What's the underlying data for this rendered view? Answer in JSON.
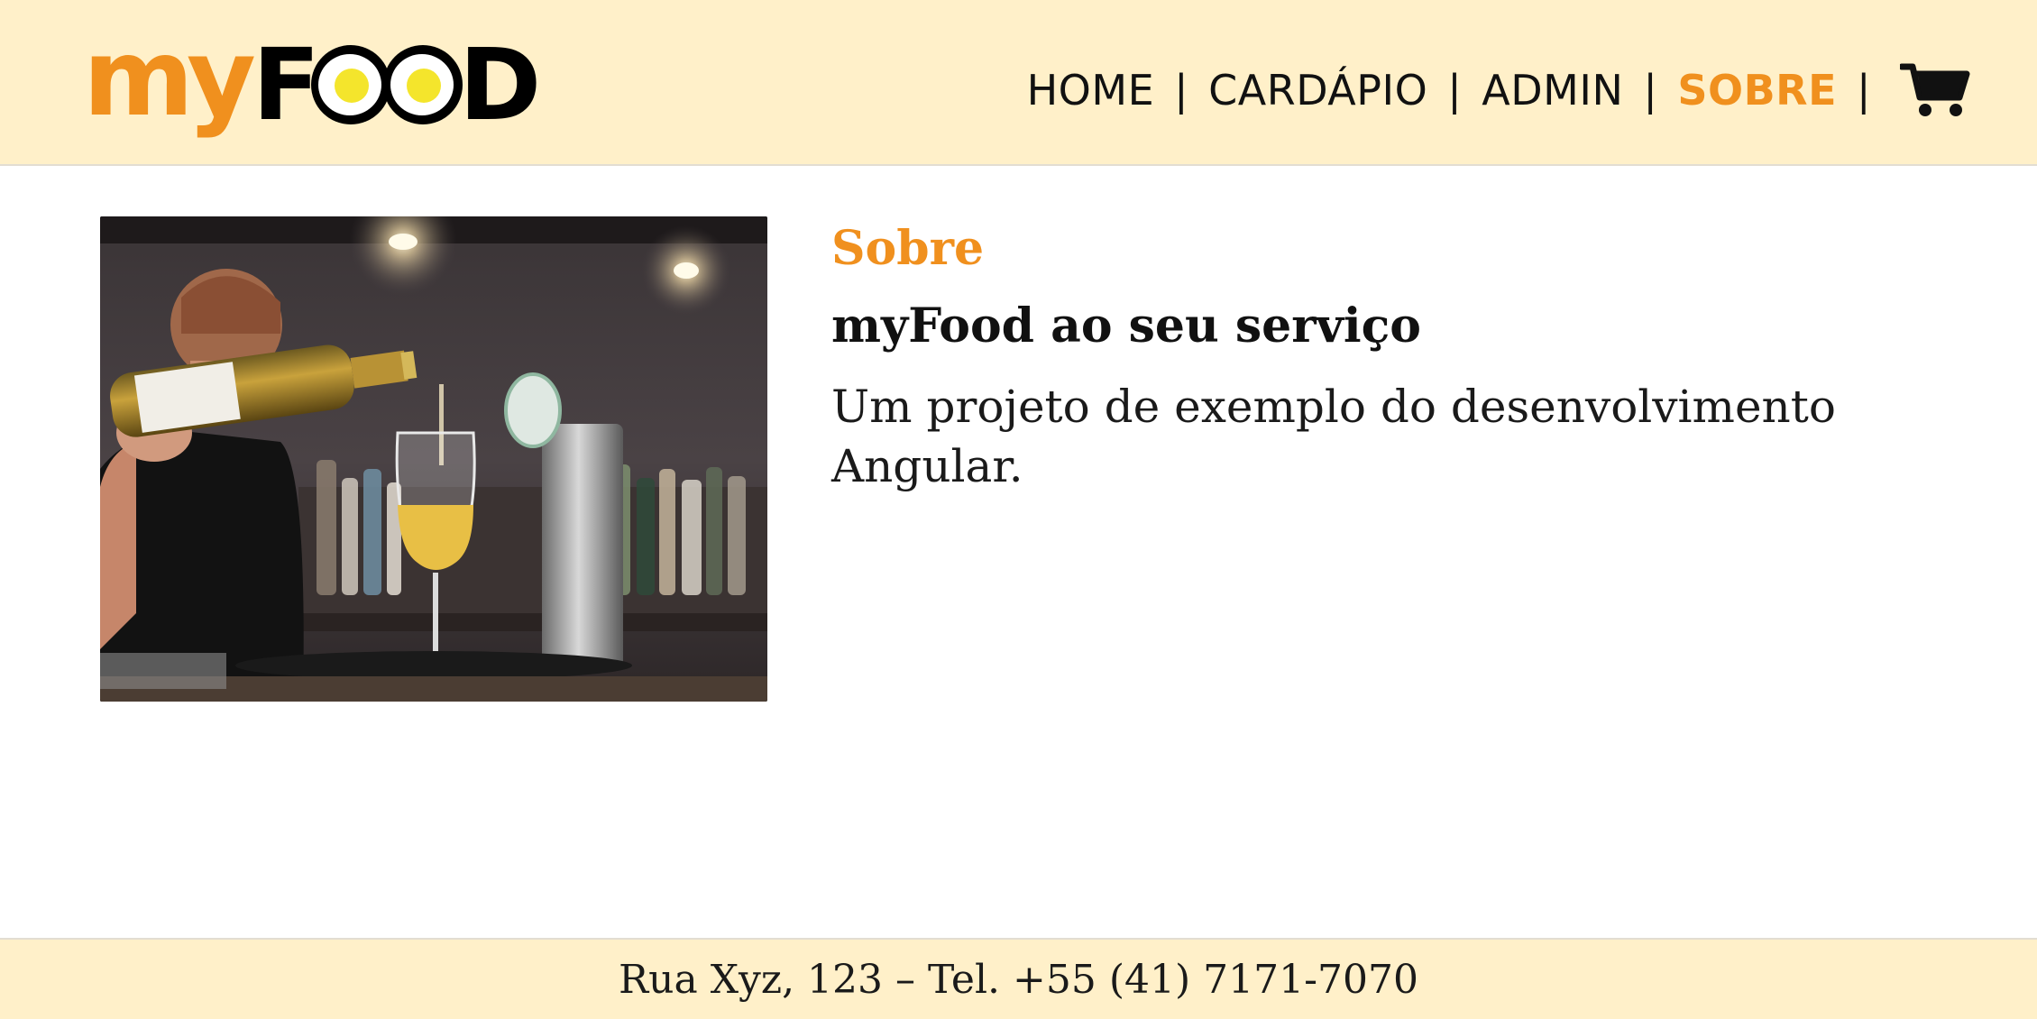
{
  "header": {
    "logo": {
      "part1": "my",
      "part2": "F",
      "part3": "D"
    },
    "nav": [
      {
        "label": "HOME",
        "active": false
      },
      {
        "label": "CARDÁPIO",
        "active": false
      },
      {
        "label": "ADMIN",
        "active": false
      },
      {
        "label": "SOBRE",
        "active": true
      }
    ],
    "separator": "|",
    "cart_icon": "shopping-cart-icon"
  },
  "main": {
    "image": "bartender-pouring-wine",
    "kicker": "Sobre",
    "title": "myFood ao seu serviço",
    "description": "Um projeto de exemplo do desenvolvimento Angular."
  },
  "footer": {
    "text": "Rua Xyz, 123 – Tel. +55 (41) 7171-7070"
  },
  "colors": {
    "accent": "#f0901e",
    "header_bg": "#fff0c9",
    "text": "#111111"
  }
}
